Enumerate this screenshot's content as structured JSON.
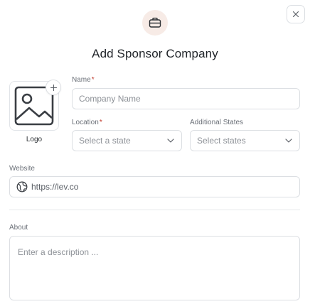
{
  "modal": {
    "title": "Add Sponsor Company",
    "icons": {
      "close": "close-icon",
      "header": "briefcase-icon"
    }
  },
  "logo": {
    "label": "Logo",
    "icons": {
      "placeholder": "image-icon",
      "add": "plus-icon"
    }
  },
  "form": {
    "name": {
      "label": "Name",
      "required_mark": "*",
      "placeholder": "Company Name"
    },
    "location": {
      "label": "Location",
      "required_mark": "*",
      "placeholder": "Select a state",
      "icon": "chevron-down-icon"
    },
    "additional_states": {
      "label": "Additional States",
      "placeholder": "Select states",
      "icon": "chevron-down-icon"
    },
    "website": {
      "label": "Website",
      "value": "https://lev.co",
      "icon": "globe-icon"
    },
    "about": {
      "label": "About",
      "placeholder": "Enter a description ..."
    }
  }
}
